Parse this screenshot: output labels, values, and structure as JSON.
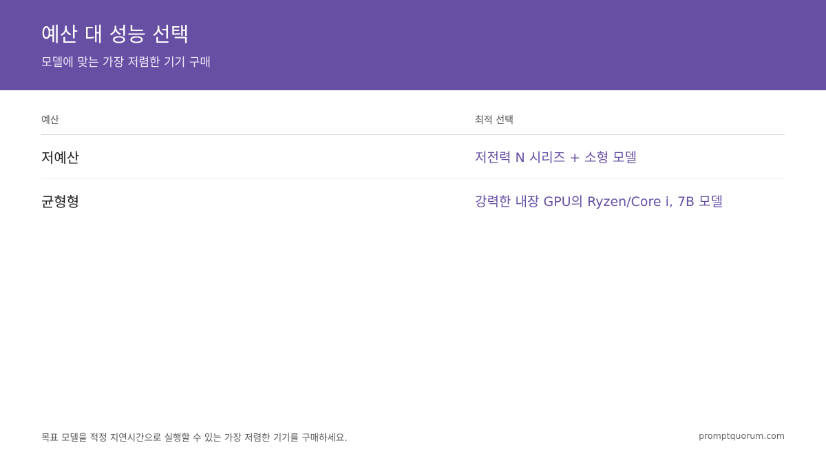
{
  "header": {
    "title": "예산 대 성능 선택",
    "subtitle": "모델에 맞는 가장 저렴한 기기 구매",
    "background_color": "#6750a4"
  },
  "table": {
    "columns": [
      "예산",
      "최적 선택"
    ],
    "rows": [
      {
        "budget": "저예산",
        "choice": "저전력 N 시리즈 + 소형 모델"
      },
      {
        "budget": "균형형",
        "choice": "강력한 내장 GPU의 Ryzen/Core i, 7B 모델"
      }
    ],
    "accent_color": "#6750a4"
  },
  "footer": {
    "note": "목표 모델을 적정 지연시간으로 실행할 수 있는 가장 저렴한 기기를 구매하세요.",
    "site": "promptquorum.com"
  }
}
